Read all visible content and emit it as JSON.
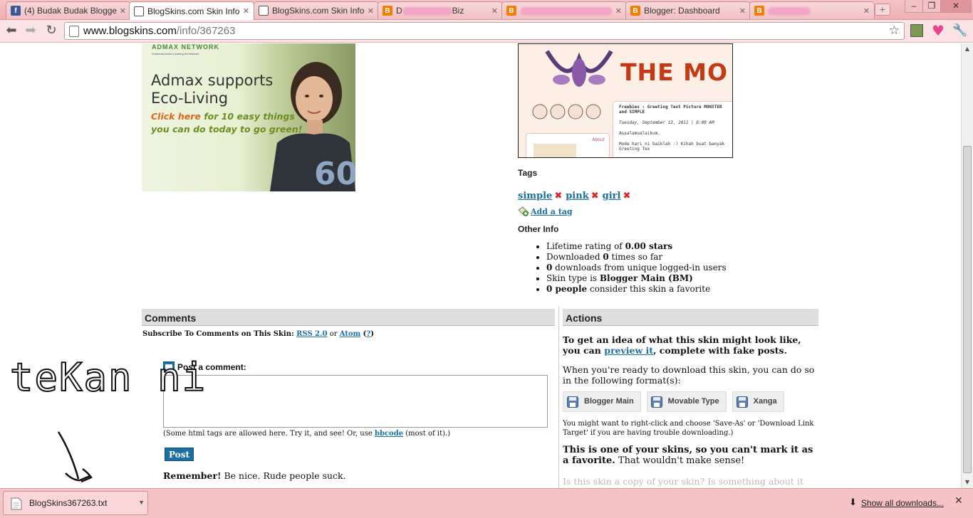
{
  "browser": {
    "tabs": [
      {
        "title": "(4) Budak Budak Blogge",
        "icon": "facebook-icon",
        "active": false
      },
      {
        "title": "BlogSkins.com Skin Info",
        "icon": "blogskins-icon",
        "active": true
      },
      {
        "title": "BlogSkins.com Skin Info",
        "icon": "blogskins-icon",
        "active": false
      },
      {
        "title": "D",
        "suffix": "Biz",
        "icon": "blogger-icon",
        "active": false
      },
      {
        "title": "",
        "icon": "blogger-icon",
        "active": false
      },
      {
        "title": "Blogger: Dashboard",
        "icon": "blogger-icon",
        "active": false
      },
      {
        "title": "",
        "icon": "blogger-icon",
        "active": false
      }
    ],
    "new_tab": "+",
    "window_buttons": [
      "–",
      "❐",
      "✕"
    ],
    "url_domain": "www.blogskins.com",
    "url_path": "/info/367263"
  },
  "ad": {
    "brand": "ADMAX NETWORK",
    "brand_sub": "Southeast Asia's Leading Ad Network",
    "headline1": "Admax supports",
    "headline2": "Eco-Living",
    "cta1_bold": "Click here",
    "cta1_rest": " for 10 easy things",
    "cta2": "you can do today to go green!",
    "shirt_number": "60"
  },
  "preview": {
    "banner_text": "THE MO",
    "post_title": "Freebies : Greeting Text Picture MONSTER and SIMPLE",
    "post_meta": "Tuesday, September 13, 2011 | 8:08 AM",
    "post_body1": "Assalamualaikum.",
    "post_body2": "Mode hari ni baiklah :) Kihah buat banyak Greeting Tex",
    "side_label": "About"
  },
  "tags": {
    "heading": "Tags",
    "items": [
      "simple",
      "pink",
      "girl"
    ],
    "add_label": "Add a tag"
  },
  "other_info": {
    "heading": "Other Info",
    "items": [
      {
        "pre": "Lifetime rating of ",
        "bold": "0.00 stars",
        "post": ""
      },
      {
        "pre": "Downloaded ",
        "bold": "0",
        "post": " times so far"
      },
      {
        "pre": "",
        "bold": "0",
        "post": " downloads from unique logged-in users"
      },
      {
        "pre": "Skin type is ",
        "bold": "Blogger Main (BM)",
        "post": ""
      },
      {
        "pre": "",
        "bold": "0 people",
        "post": " consider this skin a favorite"
      }
    ]
  },
  "comments": {
    "heading": "Comments",
    "subscribe_pre": "Subscribe To Comments on This Skin: ",
    "rss": "RSS 2.0",
    "or": " or ",
    "atom": "Atom",
    "help": "?",
    "post_label": "Post a comment:",
    "note_pre": "(Some html tags are allowed here. Try it, and see! Or, use ",
    "bbcode": "bbcode",
    "note_post": " (most of it).)",
    "post_button": "Post",
    "remember_bold": "Remember!",
    "remember_rest": " Be nice. Rude people suck."
  },
  "actions": {
    "heading": "Actions",
    "p1_pre": "To get an idea of what this skin might look like, you can ",
    "preview_link": "preview it",
    "p1_post": ", complete with fake posts.",
    "p2": "When you're ready to download this skin, you can do so in the following format(s):",
    "formats": [
      "Blogger Main",
      "Movable Type",
      "Xanga"
    ],
    "p3": "You might want to right-click and choose 'Save-As' or 'Download Link Target' if you are having trouble downloading.)",
    "p4_bold": "This is one of your skins, so you can't mark it as a favorite.",
    "p4_rest": " That wouldn't make sense!",
    "p5": "Is this skin a copy of your skin? Is something about it"
  },
  "overlay": {
    "scrawl": "teKan ni"
  },
  "downloads": {
    "file": "BlogSkins367263.txt",
    "show_all": "Show all downloads...",
    "close": "✕"
  }
}
